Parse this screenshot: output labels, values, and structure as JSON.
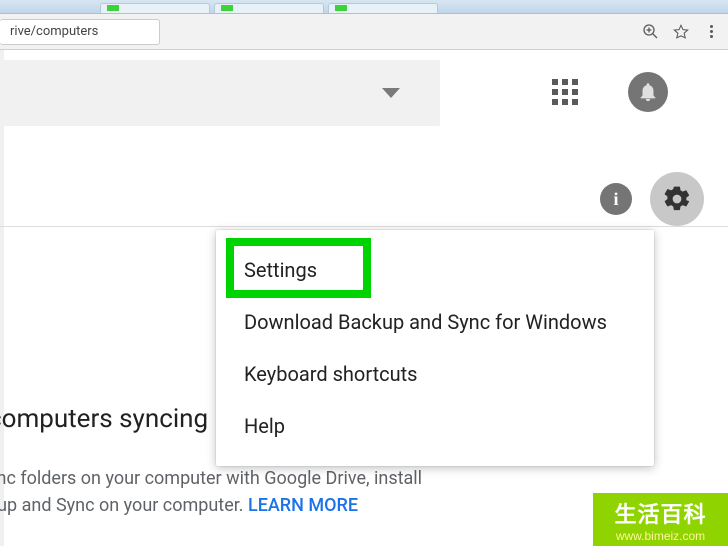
{
  "browser": {
    "url_fragment": "rive/computers"
  },
  "menu": {
    "items": [
      "Settings",
      "Download Backup and Sync for Windows",
      "Keyboard shortcuts",
      "Help"
    ]
  },
  "promo": {
    "heading_fragment": "computers syncing",
    "line1_fragment": "ync folders on your computer with Google Drive, install",
    "line2_fragment": "kup and Sync on your computer. ",
    "learn_more": "LEARN MORE"
  },
  "watermark": {
    "cjk": "生活百科",
    "url": "www.bimeiz.com"
  }
}
